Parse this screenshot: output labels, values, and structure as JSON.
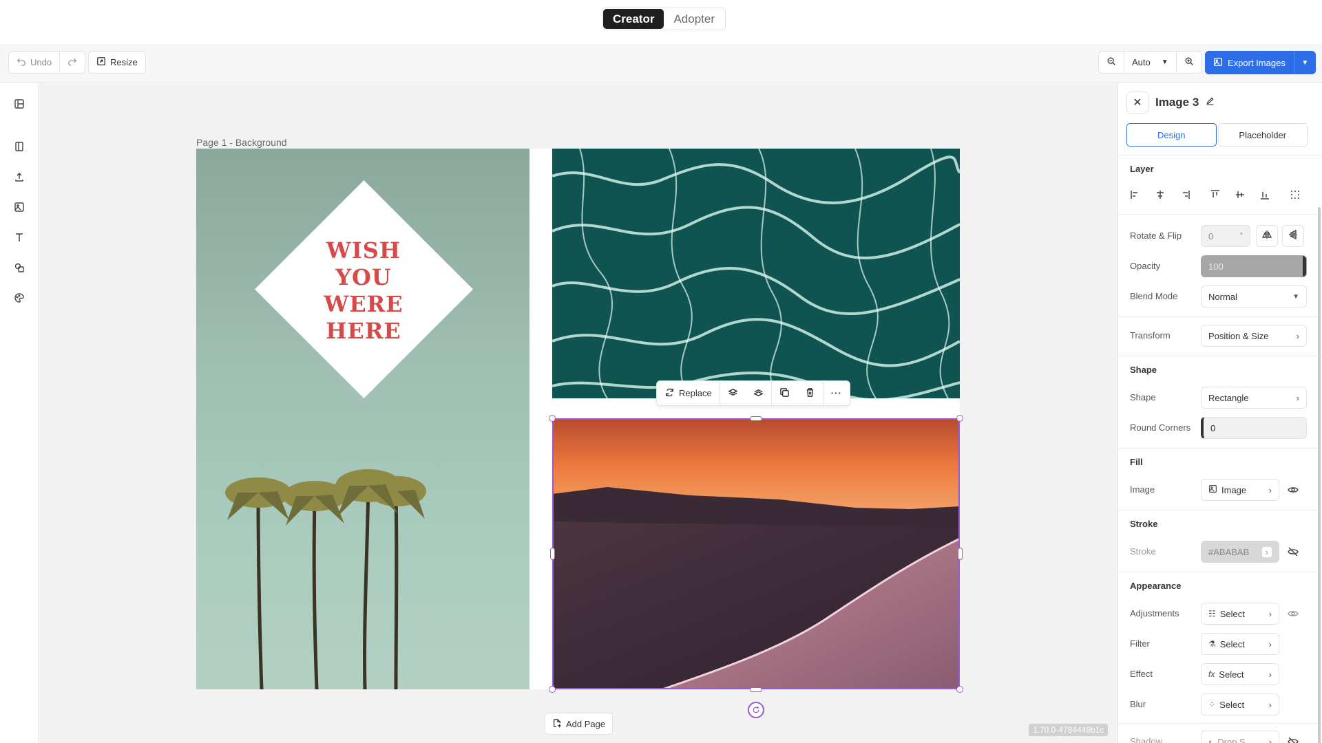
{
  "mode": {
    "creator": "Creator",
    "adopter": "Adopter"
  },
  "toolbar": {
    "undo": "Undo",
    "resize": "Resize",
    "zoom": "Auto",
    "export": "Export Images"
  },
  "rail": {
    "icons": [
      "layout-icon",
      "library-icon",
      "upload-icon",
      "image-icon",
      "text-icon",
      "shapes-icon",
      "palette-icon"
    ]
  },
  "canvas": {
    "page_label": "Page 1 - Background",
    "card_text": "WISH YOU WERE HERE",
    "context_toolbar": {
      "replace": "Replace"
    },
    "add_page": "Add Page",
    "version": "1.70.0-4784449b1c"
  },
  "panel": {
    "title": "Image 3",
    "tabs": [
      "Design",
      "Placeholder"
    ],
    "layer": {
      "title": "Layer"
    },
    "rotate": {
      "label": "Rotate & Flip",
      "value": "0",
      "unit": "°"
    },
    "opacity": {
      "label": "Opacity",
      "value": "100"
    },
    "blend": {
      "label": "Blend Mode",
      "value": "Normal"
    },
    "transform": {
      "label": "Transform",
      "value": "Position & Size"
    },
    "shape_section": {
      "title": "Shape"
    },
    "shape": {
      "label": "Shape",
      "value": "Rectangle"
    },
    "round_corners": {
      "label": "Round Corners",
      "value": "0"
    },
    "fill_section": {
      "title": "Fill"
    },
    "fill": {
      "label": "Image",
      "value": "Image"
    },
    "stroke_section": {
      "title": "Stroke"
    },
    "stroke": {
      "label": "Stroke",
      "value": "#ABABAB"
    },
    "appearance_section": {
      "title": "Appearance"
    },
    "adjustments": {
      "label": "Adjustments",
      "value": "Select"
    },
    "filter": {
      "label": "Filter",
      "value": "Select"
    },
    "effect": {
      "label": "Effect",
      "value": "Select"
    },
    "blur": {
      "label": "Blur",
      "value": "Select"
    },
    "shadow": {
      "label": "Shadow",
      "value": "Drop S..."
    }
  },
  "colors": {
    "accent": "#2d6ee8",
    "selection": "#9b59d0",
    "card_text": "#d64a48"
  }
}
